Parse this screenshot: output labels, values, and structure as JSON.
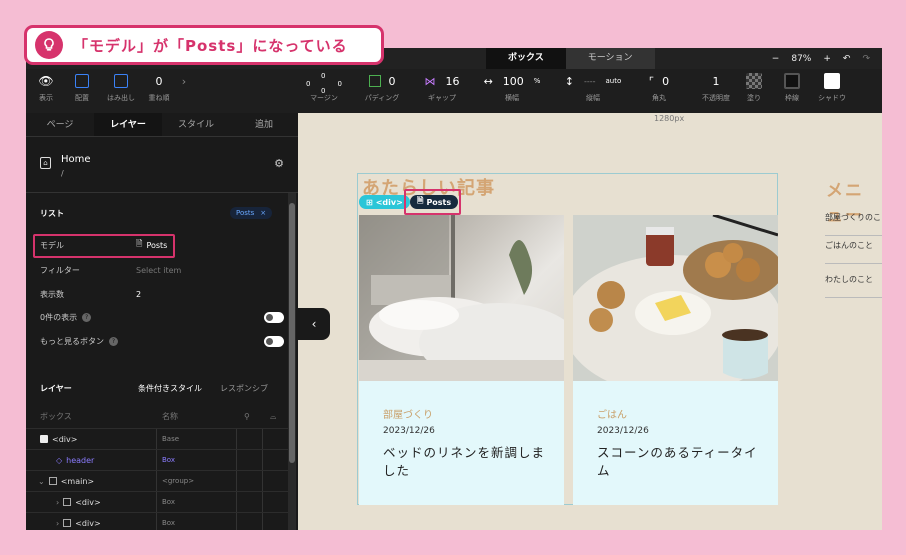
{
  "callout": {
    "text": "「モデル」が「Posts」になっている",
    "icon": "lightbulb-icon"
  },
  "topbar": {
    "tab_box": "ボックス",
    "tab_motion": "モーション",
    "zoom": "87%",
    "minus": "−",
    "plus": "+"
  },
  "toolbar": {
    "display": "表示",
    "placement": "配置",
    "overflow": "はみ出し",
    "stack_value": "0",
    "stack": "重ね順",
    "margin_top": "0",
    "margin_left": "0",
    "margin_right": "0",
    "margin_bottom": "0",
    "margin": "マージン",
    "padding_value": "0",
    "padding": "パディング",
    "gap_value": "16",
    "gap": "ギャップ",
    "width_value": "100",
    "width_unit": "%",
    "width": "横幅",
    "height_value": "----",
    "height_unit": "auto",
    "height": "縦幅",
    "radius_value": "0",
    "radius": "角丸",
    "opacity_value": "1",
    "opacity": "不透明度",
    "fill": "塗り",
    "border": "枠線",
    "shadow": "シャドウ"
  },
  "panel": {
    "tabs": [
      "ページ",
      "レイヤー",
      "スタイル",
      "追加"
    ],
    "home_title": "Home",
    "home_path": "/",
    "list_label": "リスト",
    "list_badge": "Posts",
    "list_badge_close": "×",
    "model_label": "モデル",
    "model_value": "Posts",
    "filter_label": "フィルター",
    "filter_placeholder": "Select item",
    "count_label": "表示数",
    "count_value": "2",
    "empty_label": "0件の表示",
    "more_label": "もっと見るボタン",
    "layers_label": "レイヤー",
    "cond_style": "条件付きスタイル",
    "responsive": "レスポンシブ",
    "col_box": "ボックス",
    "col_name": "名称",
    "layers": [
      {
        "name": "<div>",
        "type": "Base"
      },
      {
        "name": "header",
        "type": "Box"
      },
      {
        "name": "<main>",
        "type": "<group>"
      },
      {
        "name": "<div>",
        "type": "Box"
      },
      {
        "name": "<div>",
        "type": "Box"
      }
    ]
  },
  "canvas": {
    "width_label": "1280px",
    "section_title": "あたらしい記事",
    "tag_div": "<div>",
    "tag_posts": "Posts",
    "cards": [
      {
        "category": "部屋づくり",
        "date": "2023/12/26",
        "title": "ベッドのリネンを新調しました"
      },
      {
        "category": "ごはん",
        "date": "2023/12/26",
        "title": "スコーンのあるティータイム"
      }
    ],
    "menu_title": "メニュー",
    "menu_items": [
      "部屋づくりのこと",
      "ごはんのこと",
      "わたしのこと"
    ]
  }
}
